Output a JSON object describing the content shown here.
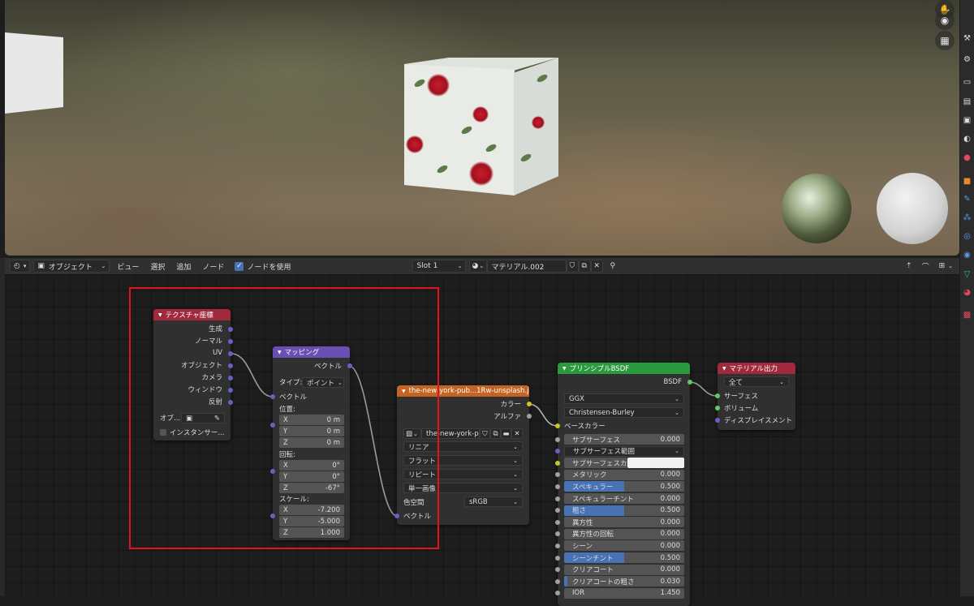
{
  "header": {
    "mode": "オブジェクト",
    "menu": [
      "ビュー",
      "選択",
      "追加",
      "ノード"
    ],
    "use_nodes_label": "ノードを使用",
    "slot": "Slot 1",
    "material": "マテリアル.002"
  },
  "nodes": {
    "texcoord": {
      "title": "テクスチャ座標",
      "outputs": [
        "生成",
        "ノーマル",
        "UV",
        "オブジェクト",
        "カメラ",
        "ウィンドウ",
        "反射"
      ],
      "object_label": "オブ...",
      "instancer_label": "インスタンサー..."
    },
    "mapping": {
      "title": "マッピング",
      "output": "ベクトル",
      "type_label": "タイプ:",
      "type_value": "ポイント",
      "vector_label": "ベクトル",
      "location_label": "位置:",
      "location": [
        {
          "axis": "X",
          "value": "0 m"
        },
        {
          "axis": "Y",
          "value": "0 m"
        },
        {
          "axis": "Z",
          "value": "0 m"
        }
      ],
      "rotation_label": "回転:",
      "rotation": [
        {
          "axis": "X",
          "value": "0°"
        },
        {
          "axis": "Y",
          "value": "0°"
        },
        {
          "axis": "Z",
          "value": "-67°"
        }
      ],
      "scale_label": "スケール:",
      "scale": [
        {
          "axis": "X",
          "value": "-7.200"
        },
        {
          "axis": "Y",
          "value": "-5.000"
        },
        {
          "axis": "Z",
          "value": "1.000"
        }
      ]
    },
    "image": {
      "title": "the-new-york-pub...1Rw-unsplash.jpg",
      "outputs": [
        "カラー",
        "アルファ"
      ],
      "image_name": "the-new-york-p...",
      "interpolation": "リニア",
      "projection": "フラット",
      "extension": "リピート",
      "source": "単一画像",
      "colorspace_label": "色空間",
      "colorspace": "sRGB",
      "vector_label": "ベクトル"
    },
    "bsdf": {
      "title": "プリンシプルBSDF",
      "output": "BSDF",
      "distribution": "GGX",
      "subsurface_method": "Christensen-Burley",
      "base_color_label": "ベースカラー",
      "params": [
        {
          "label": "サブサーフェス",
          "value": "0.000",
          "fill": 0,
          "socket": "gray"
        },
        {
          "label": "サブサーフェス範囲",
          "value": "",
          "fill": 0,
          "socket": "vec",
          "dropdown": true
        },
        {
          "label": "サブサーフェスカ...",
          "value": "",
          "fill": 0,
          "socket": "col",
          "swatch": true
        },
        {
          "label": "メタリック",
          "value": "0.000",
          "fill": 0,
          "socket": "gray"
        },
        {
          "label": "スペキュラー",
          "value": "0.500",
          "fill": 0.5,
          "socket": "gray"
        },
        {
          "label": "スペキュラーチント",
          "value": "0.000",
          "fill": 0,
          "socket": "gray"
        },
        {
          "label": "粗さ",
          "value": "0.500",
          "fill": 0.5,
          "socket": "gray"
        },
        {
          "label": "異方性",
          "value": "0.000",
          "fill": 0,
          "socket": "gray"
        },
        {
          "label": "異方性の回転",
          "value": "0.000",
          "fill": 0,
          "socket": "gray"
        },
        {
          "label": "シーン",
          "value": "0.000",
          "fill": 0,
          "socket": "gray"
        },
        {
          "label": "シーンチント",
          "value": "0.500",
          "fill": 0.5,
          "socket": "gray"
        },
        {
          "label": "クリアコート",
          "value": "0.000",
          "fill": 0,
          "socket": "gray"
        },
        {
          "label": "クリアコートの粗さ",
          "value": "0.030",
          "fill": 0.03,
          "socket": "gray"
        },
        {
          "label": "IOR",
          "value": "1.450",
          "fill": 0,
          "socket": "gray"
        }
      ]
    },
    "output": {
      "title": "マテリアル出力",
      "target": "全て",
      "inputs": [
        "サーフェス",
        "ボリューム",
        "ディスプレイスメント"
      ]
    }
  },
  "colors": {
    "texcoord_header": "#a02a3c",
    "mapping_header": "#6a4fb3",
    "image_header": "#c46424",
    "bsdf_header": "#2b9a3e",
    "output_header": "#a02a3c",
    "annotation": "#e0141a"
  }
}
